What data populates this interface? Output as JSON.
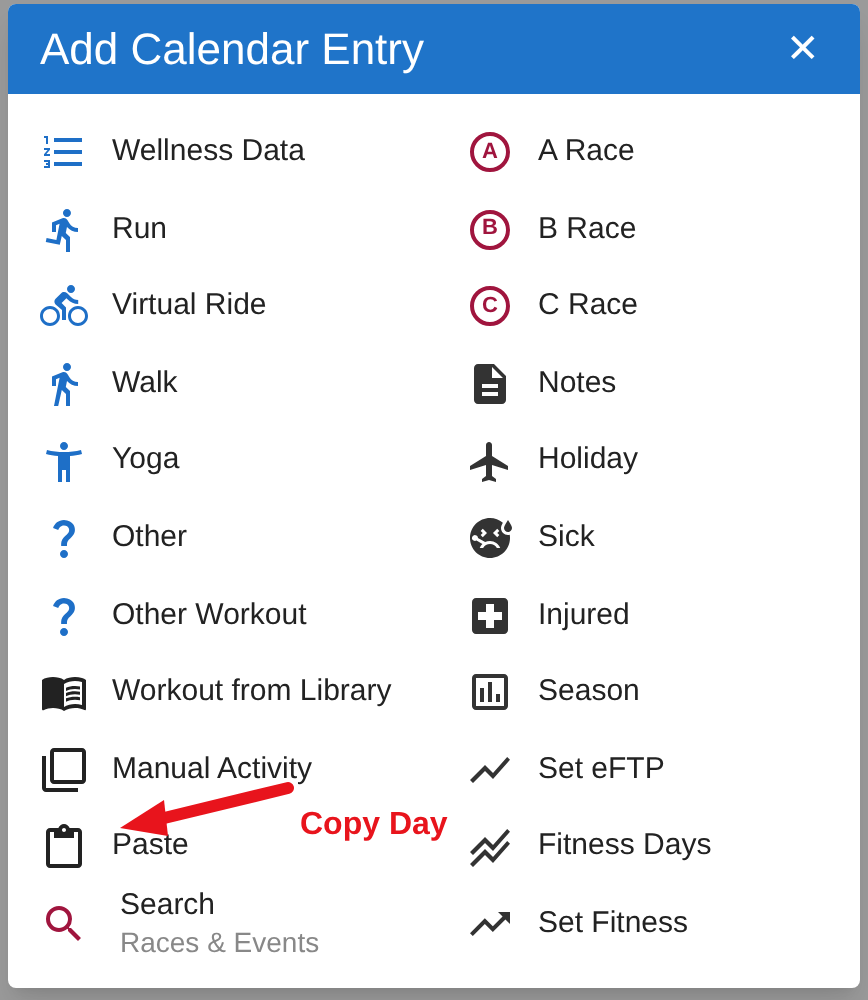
{
  "dialog": {
    "title": "Add Calendar Entry",
    "close_label": "✕"
  },
  "left_items": [
    {
      "label": "Wellness Data"
    },
    {
      "label": "Run"
    },
    {
      "label": "Virtual Ride"
    },
    {
      "label": "Walk"
    },
    {
      "label": "Yoga"
    },
    {
      "label": "Other"
    },
    {
      "label": "Other Workout"
    },
    {
      "label": "Workout from Library"
    },
    {
      "label": "Manual Activity"
    },
    {
      "label": "Paste"
    },
    {
      "label": "Search",
      "subtitle": "Races & Events"
    }
  ],
  "right_items": [
    {
      "label": "A Race",
      "badge": "A"
    },
    {
      "label": "B Race",
      "badge": "B"
    },
    {
      "label": "C Race",
      "badge": "C"
    },
    {
      "label": "Notes"
    },
    {
      "label": "Holiday"
    },
    {
      "label": "Sick"
    },
    {
      "label": "Injured"
    },
    {
      "label": "Season"
    },
    {
      "label": "Set eFTP"
    },
    {
      "label": "Fitness Days"
    },
    {
      "label": "Set Fitness"
    }
  ],
  "annotation": {
    "text": "Copy Day"
  }
}
